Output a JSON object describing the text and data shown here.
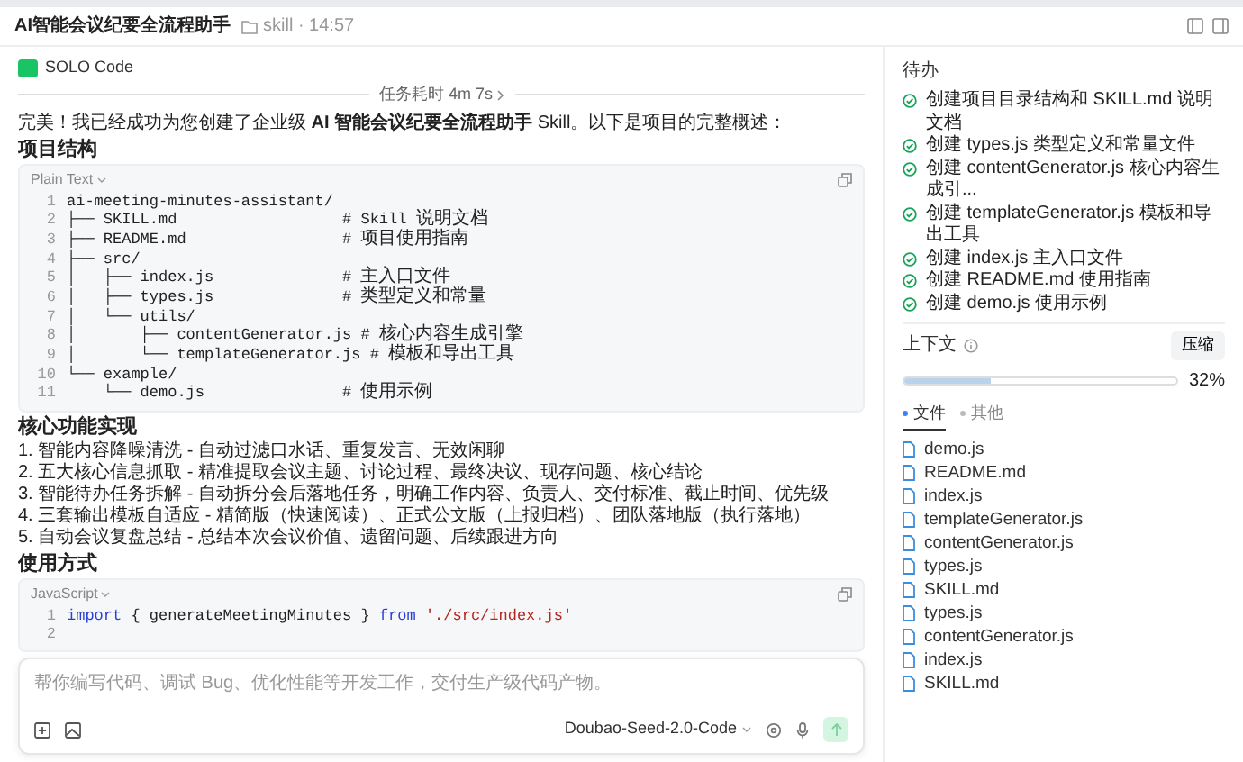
{
  "header": {
    "title": "AI智能会议纪要全流程助手",
    "location": "skill · 14:57"
  },
  "chat": {
    "agent": "SOLO Code",
    "duration": "任务耗时 4m 7s",
    "intro": "完美！我已经成功为您创建了企业级 **AI 智能会议纪要全流程助手** Skill。以下是项目的完整概述：",
    "blocks": [
      {
        "kind": "heading",
        "text": "项目结构"
      },
      {
        "kind": "code",
        "language": "Plain Text",
        "lines": [
          {
            "number": "1",
            "segments": [
              {
                "kind": "plain",
                "text": "ai-meeting-minutes-assistant/"
              }
            ]
          },
          {
            "number": "2",
            "segments": [
              {
                "kind": "plain",
                "text": "├── SKILL.md                  # Skill 说明文档"
              }
            ]
          },
          {
            "number": "3",
            "segments": [
              {
                "kind": "plain",
                "text": "├── README.md                 # 项目使用指南"
              }
            ]
          },
          {
            "number": "4",
            "segments": [
              {
                "kind": "plain",
                "text": "├── src/"
              }
            ]
          },
          {
            "number": "5",
            "segments": [
              {
                "kind": "plain",
                "text": "│   ├── index.js              # 主入口文件"
              }
            ]
          },
          {
            "number": "6",
            "segments": [
              {
                "kind": "plain",
                "text": "│   ├── types.js              # 类型定义和常量"
              }
            ]
          },
          {
            "number": "7",
            "segments": [
              {
                "kind": "plain",
                "text": "│   └── utils/"
              }
            ]
          },
          {
            "number": "8",
            "segments": [
              {
                "kind": "plain",
                "text": "│       ├── contentGenerator.js # 核心内容生成引擎"
              }
            ]
          },
          {
            "number": "9",
            "segments": [
              {
                "kind": "plain",
                "text": "│       └── templateGenerator.js # 模板和导出工具"
              }
            ]
          },
          {
            "number": "10",
            "segments": [
              {
                "kind": "plain",
                "text": "└── example/"
              }
            ]
          },
          {
            "number": "11",
            "segments": [
              {
                "kind": "plain",
                "text": "    └── demo.js               # 使用示例"
              }
            ]
          }
        ]
      },
      {
        "kind": "heading",
        "text": "核心功能实现"
      },
      {
        "kind": "list",
        "items": [
          "1. 智能内容降噪清洗 - 自动过滤口水话、重复发言、无效闲聊",
          "2. 五大核心信息抓取 - 精准提取会议主题、讨论过程、最终决议、现存问题、核心结论",
          "3. 智能待办任务拆解 - 自动拆分会后落地任务，明确工作内容、负责人、交付标准、截止时间、优先级",
          "4. 三套输出模板自适应 - 精简版（快速阅读）、正式公文版（上报归档）、团队落地版（执行落地）",
          "5. 自动会议复盘总结 - 总结本次会议价值、遗留问题、后续跟进方向"
        ]
      },
      {
        "kind": "heading",
        "text": "使用方式"
      },
      {
        "kind": "code",
        "language": "JavaScript",
        "lines": [
          {
            "number": "1",
            "segments": [
              {
                "kind": "keyword",
                "text": "import"
              },
              {
                "kind": "plain",
                "text": " { generateMeetingMinutes } "
              },
              {
                "kind": "keyword",
                "text": "from"
              },
              {
                "kind": "string",
                "text": " './src/index.js'"
              }
            ]
          },
          {
            "number": "2"
          }
        ]
      }
    ]
  },
  "composer": {
    "placeholder": "帮你编写代码、调试 Bug、优化性能等开发工作，交付生产级代码产物。",
    "model": "Doubao-Seed-2.0-Code"
  },
  "todo": {
    "title": "待办",
    "items": [
      {
        "text": "创建项目目录结构和 SKILL.md 说明文档",
        "done": true
      },
      {
        "text": "创建 types.js 类型定义和常量文件",
        "done": true
      },
      {
        "text": "创建 contentGenerator.js 核心内容生成引...",
        "done": true
      },
      {
        "text": "创建 templateGenerator.js 模板和导出工具",
        "done": true
      },
      {
        "text": "创建 index.js 主入口文件",
        "done": true
      },
      {
        "text": "创建 README.md 使用指南",
        "done": true
      },
      {
        "text": "创建 demo.js 使用示例",
        "done": true
      }
    ]
  },
  "context": {
    "title": "上下文",
    "compress_label": "压缩",
    "level": 0.32,
    "reading": "32%",
    "tabs": [
      {
        "label": "文件",
        "selected": true
      },
      {
        "label": "其他",
        "selected": false
      }
    ],
    "files": [
      "demo.js",
      "README.md",
      "index.js",
      "templateGenerator.js",
      "contentGenerator.js",
      "types.js",
      "SKILL.md",
      "types.js",
      "contentGenerator.js",
      "index.js",
      "SKILL.md"
    ]
  }
}
